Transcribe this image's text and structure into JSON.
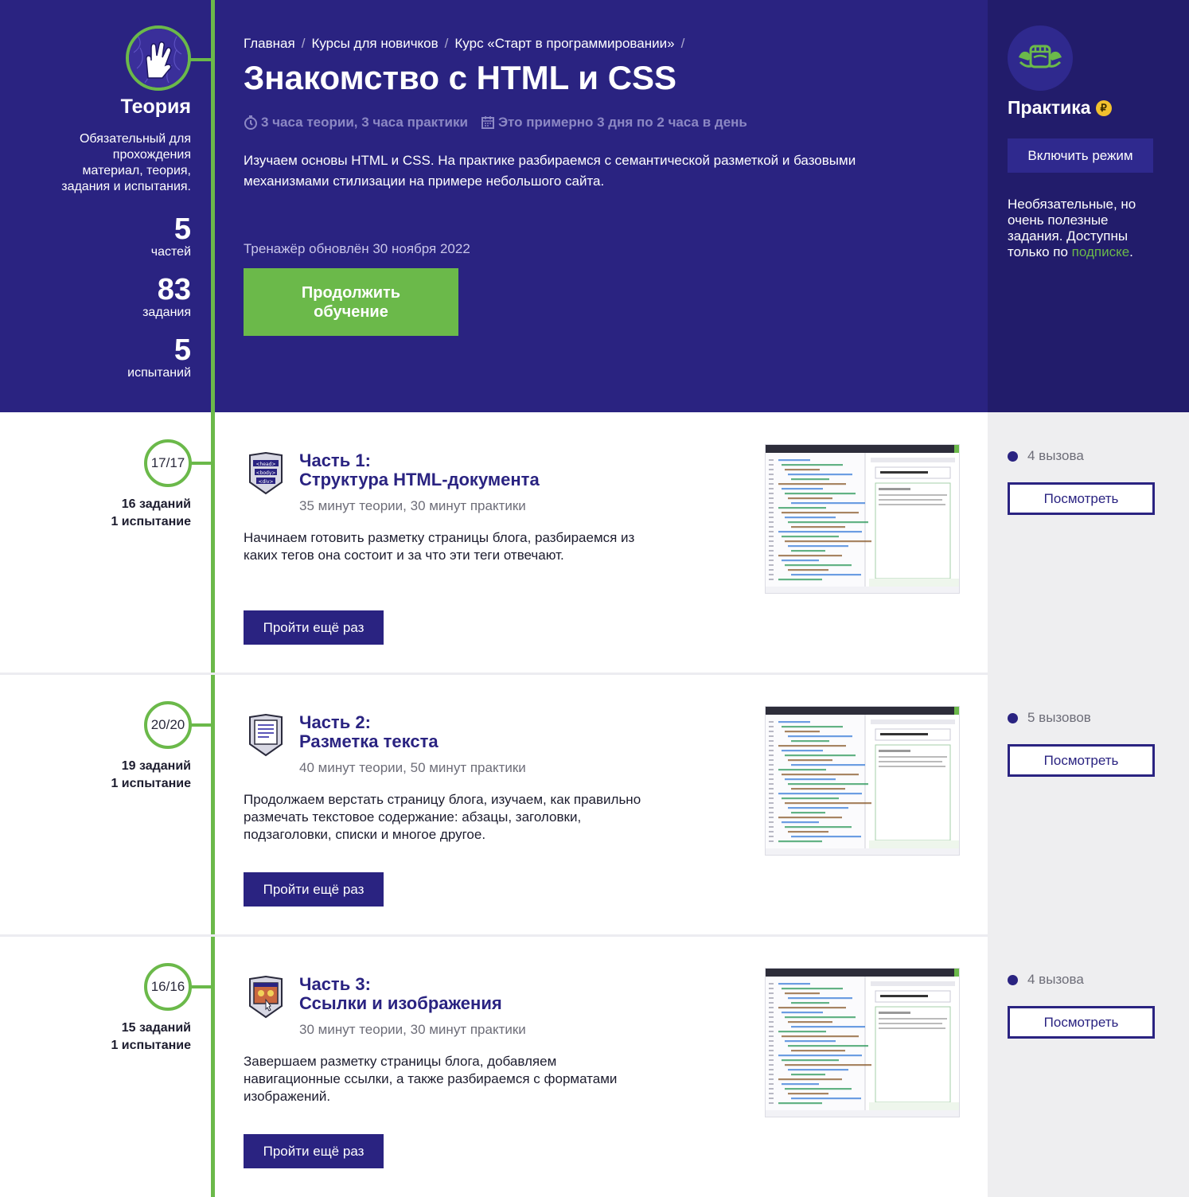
{
  "hero": {
    "breadcrumbs": [
      "Главная",
      "Курсы для новичков",
      "Курс «Старт в программировании»"
    ],
    "title": "Знакомство с HTML и CSS",
    "meta_time": "3 часа теории, 3 часа практики",
    "meta_schedule": "Это примерно 3 дня по 2 часа в день",
    "description": "Изучаем основы HTML и CSS. На практике разбираемся с семантической разметкой и базовыми механизмами стилизации на примере небольшого сайта.",
    "updated": "Тренажёр обновлён 30 ноября 2022",
    "continue_label": "Продолжить обучение"
  },
  "theory": {
    "title": "Теория",
    "description": "Обязательный для прохождения материал, теория, задания и испытания.",
    "stats": [
      {
        "value": "5",
        "label": "частей"
      },
      {
        "value": "83",
        "label": "задания"
      },
      {
        "value": "5",
        "label": "испытаний"
      }
    ]
  },
  "practice": {
    "title": "Практика",
    "coin_symbol": "₽",
    "enable_label": "Включить режим",
    "description_before": "Необязательные, но очень полезные задания. Доступны только по ",
    "description_link": "подписке",
    "description_after": "."
  },
  "parts": [
    {
      "progress": "17/17",
      "tasks": "16 заданий",
      "trials": "1 испытание",
      "number": "Часть 1:",
      "name": "Структура HTML-документа",
      "duration": "35 минут теории, 30 минут практики",
      "description": "Начинаем готовить разметку страницы блога, разбираемся из каких тегов она состоит и за что эти теги отвечают.",
      "repeat_label": "Пройти ещё раз",
      "calls": "4 вызова",
      "view_label": "Посмотреть",
      "icon": "html-tags-icon"
    },
    {
      "progress": "20/20",
      "tasks": "19 заданий",
      "trials": "1 испытание",
      "number": "Часть 2:",
      "name": "Разметка текста",
      "duration": "40 минут теории, 50 минут практики",
      "description": "Продолжаем верстать страницу блога, изучаем, как правильно размечать текстовое содержание: абзацы, заголовки, подзаголовки, списки и многое другое.",
      "repeat_label": "Пройти ещё раз",
      "calls": "5 вызовов",
      "view_label": "Посмотреть",
      "icon": "text-document-icon"
    },
    {
      "progress": "16/16",
      "tasks": "15 заданий",
      "trials": "1 испытание",
      "number": "Часть 3:",
      "name": "Ссылки и изображения",
      "duration": "30 минут теории, 30 минут практики",
      "description": "Завершаем разметку страницы блога, добавляем навигационные ссылки, а также разбираемся с форматами изображений.",
      "repeat_label": "Пройти ещё раз",
      "calls": "4 вызова",
      "view_label": "Посмотреть",
      "icon": "image-link-icon"
    }
  ],
  "colors": {
    "hero_bg": "#2a2381",
    "hero_right_bg": "#221c6b",
    "accent_green": "#6bb94a",
    "coin_yellow": "#f2c12e"
  }
}
